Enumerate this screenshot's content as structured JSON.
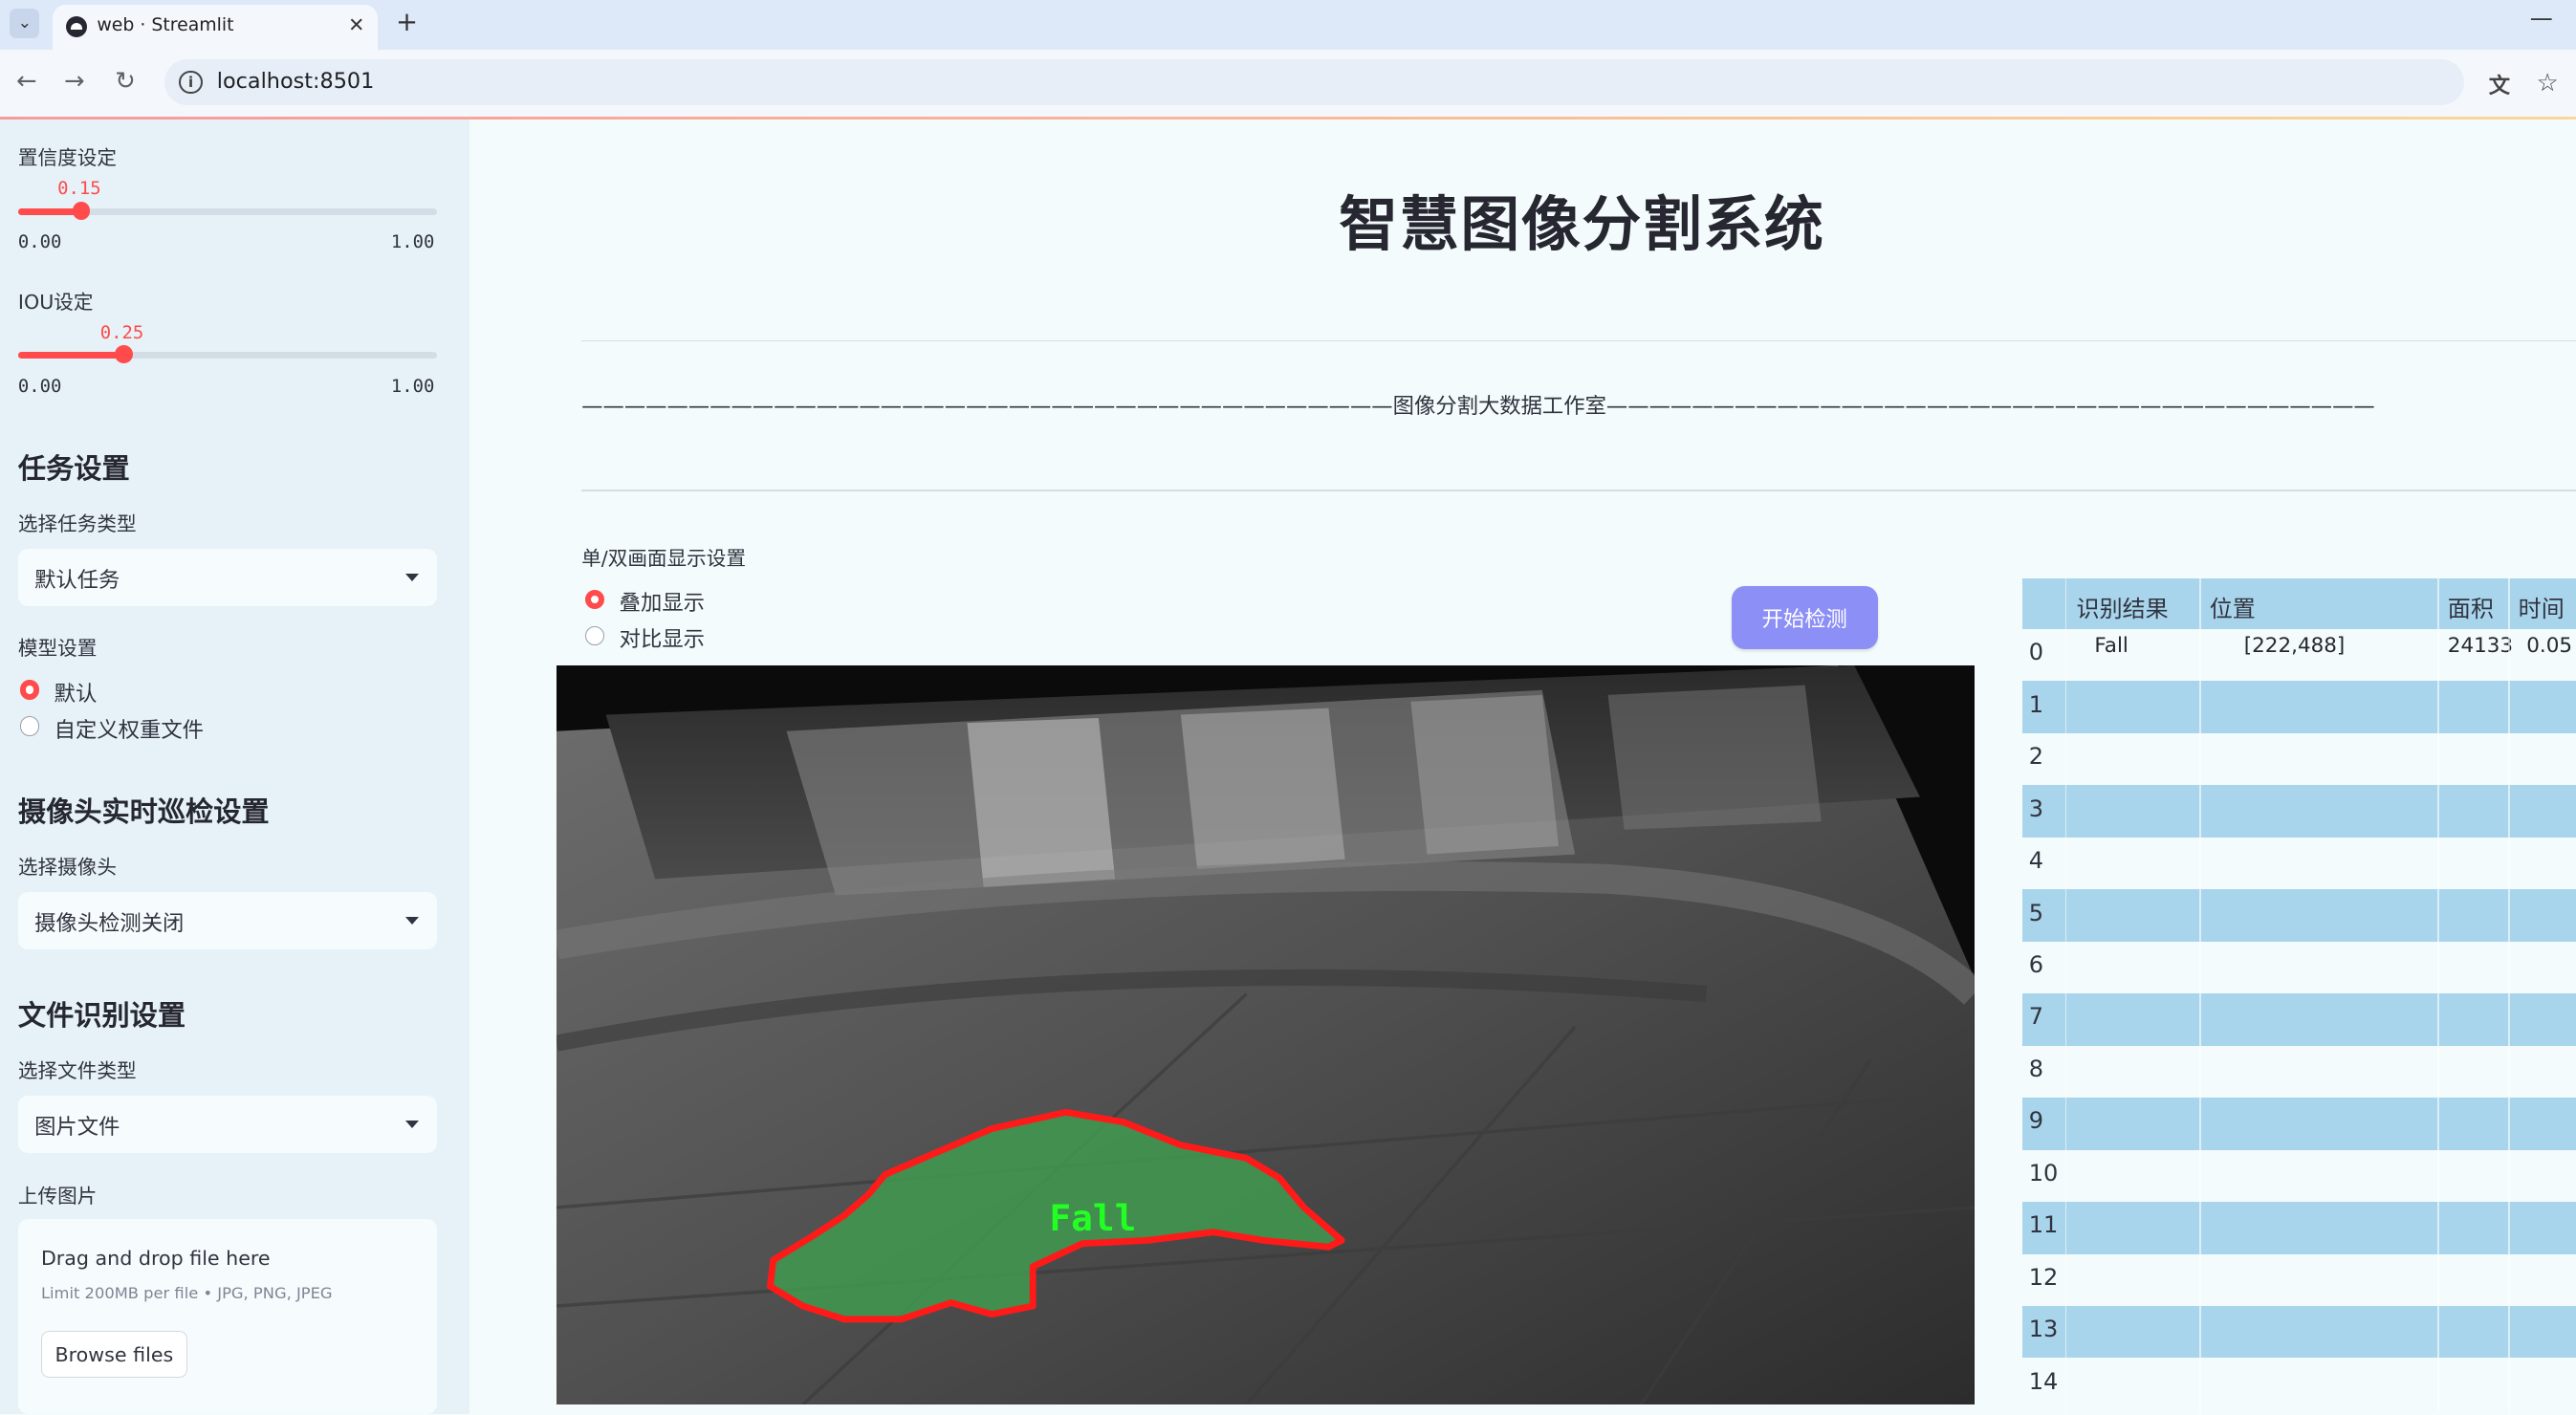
{
  "browser": {
    "tab_title": "web · Streamlit",
    "tab_close": "✕",
    "new_tab": "+",
    "minimize": "—",
    "url": "localhost:8501",
    "back": "←",
    "forward": "→",
    "reload": "↻",
    "translate": "文",
    "bookmark": "☆"
  },
  "sidebar": {
    "confidence": {
      "label": "置信度设定",
      "value": "0.15",
      "min": "0.00",
      "max": "1.00",
      "level": 0.15
    },
    "iou": {
      "label": "IOU设定",
      "value": "0.25",
      "min": "0.00",
      "max": "1.00",
      "level": 0.25
    },
    "task_section": "任务设置",
    "task_type_label": "选择任务类型",
    "task_type_value": "默认任务",
    "model_label": "模型设置",
    "model_options": [
      {
        "label": "默认",
        "selected": true
      },
      {
        "label": "自定义权重文件",
        "selected": false
      }
    ],
    "camera_section": "摄像头实时巡检设置",
    "camera_label": "选择摄像头",
    "camera_value": "摄像头检测关闭",
    "file_section": "文件识别设置",
    "file_type_label": "选择文件类型",
    "file_type_value": "图片文件",
    "upload_label": "上传图片",
    "upload_main": "Drag and drop file here",
    "upload_sub": "Limit 200MB per file • JPG, PNG, JPEG",
    "upload_button": "Browse files"
  },
  "main": {
    "title": "智慧图像分割系统",
    "subtitle": "——————————————————————————————————————图像分割大数据工作室——————————————————————————————————————",
    "display_mode_label": "单/双画面显示设置",
    "display_options": [
      {
        "label": "叠加显示",
        "selected": true
      },
      {
        "label": "对比显示",
        "selected": false
      }
    ],
    "start_button": "开始检测",
    "detection_label": "Fall"
  },
  "table": {
    "columns": [
      "识别结果",
      "位置",
      "面积",
      "时间"
    ],
    "rows": [
      {
        "index": "0",
        "result": "Fall",
        "position": "[222,488]",
        "area": "24133",
        "time": "0.05"
      },
      {
        "index": "1"
      },
      {
        "index": "2"
      },
      {
        "index": "3"
      },
      {
        "index": "4"
      },
      {
        "index": "5"
      },
      {
        "index": "6"
      },
      {
        "index": "7"
      },
      {
        "index": "8"
      },
      {
        "index": "9"
      },
      {
        "index": "10"
      },
      {
        "index": "11"
      },
      {
        "index": "12"
      },
      {
        "index": "13"
      },
      {
        "index": "14"
      }
    ]
  },
  "colors": {
    "accent": "#ff4b4b",
    "button": "#8c8ff5",
    "table_stripe": "#a8d5ec",
    "mask_fill": "#3f9a4f",
    "mask_outline": "#ff1a1a",
    "label_green": "#22ff22"
  }
}
